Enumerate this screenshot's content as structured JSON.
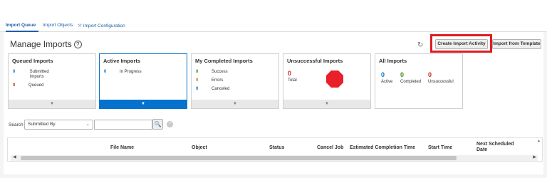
{
  "tabs": [
    {
      "label": "Import Queue",
      "active": true
    },
    {
      "label": "Import Objects",
      "active": false
    },
    {
      "label": "Import Configuration",
      "active": false
    }
  ],
  "header": {
    "title": "Manage Imports",
    "help": "?",
    "buttons": {
      "create": "Create Import Activity",
      "template": "Import from Template"
    }
  },
  "cards": {
    "queued": {
      "title": "Queued Imports",
      "rows": [
        {
          "count": "0",
          "label1": "Submitted",
          "label2": "Imports"
        },
        {
          "count": "0",
          "label": "Queued"
        }
      ]
    },
    "active": {
      "title": "Active Imports",
      "rows": [
        {
          "count": "0",
          "label": "In Progress"
        }
      ]
    },
    "completed": {
      "title": "My Completed Imports",
      "rows": [
        {
          "count": "0",
          "label": "Success"
        },
        {
          "count": "0",
          "label": "Errors"
        },
        {
          "count": "0",
          "label": "Canceled"
        }
      ]
    },
    "unsuccessful": {
      "title": "Unsuccessful Imports",
      "count": "0",
      "label": "Total"
    },
    "all": {
      "title": "All Imports",
      "stats": [
        {
          "count": "0",
          "label": "Active"
        },
        {
          "count": "0",
          "label": "Completed"
        },
        {
          "count": "0",
          "label": "Unsuccessful"
        }
      ]
    }
  },
  "search": {
    "label": "Search",
    "selected": "Submitted By",
    "value": ""
  },
  "table": {
    "columns": [
      "File Name",
      "Object",
      "Status",
      "Cancel Job",
      "Estimated Completion Time",
      "Start Time",
      "Next Scheduled",
      "Date"
    ]
  },
  "colors": {
    "accent": "#0572ce",
    "highlight": "#e01b24",
    "stop": "#e8202a"
  }
}
